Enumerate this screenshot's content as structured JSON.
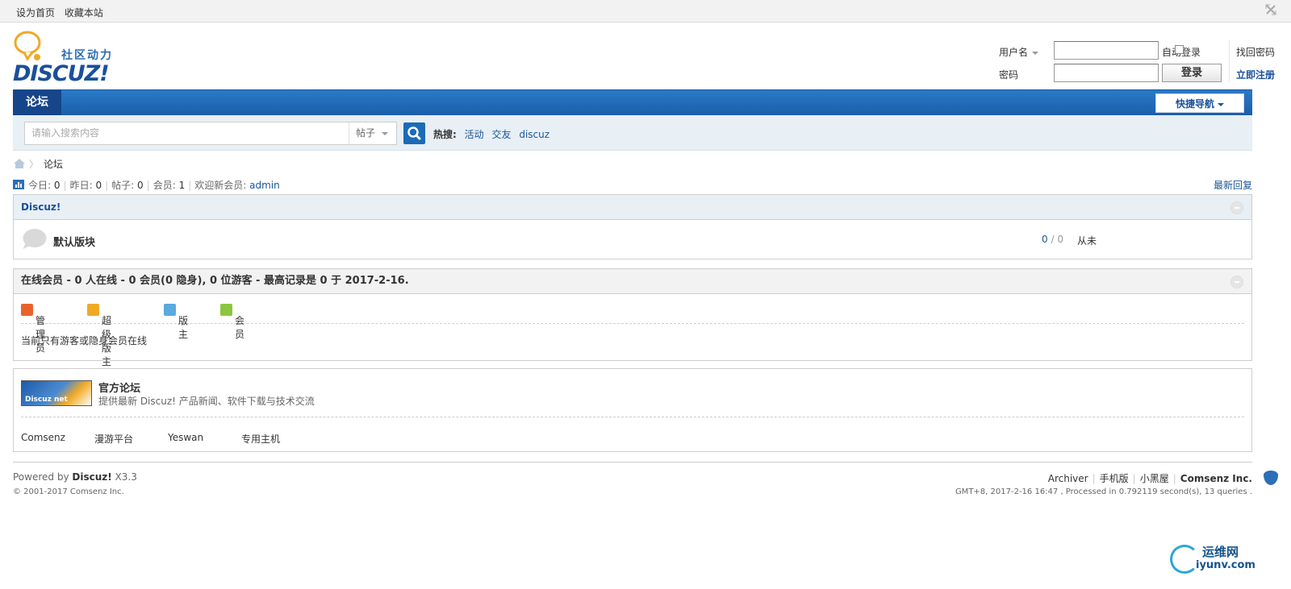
{
  "topbar": {
    "links": [
      "设为首页",
      "收藏本站"
    ]
  },
  "logo": {
    "tagline": "社区动力",
    "wordmark": "DISCUZ!"
  },
  "login": {
    "username_label": "用户名",
    "password_label": "密码",
    "autologin_label": "自动登录",
    "login_button": "登录",
    "find_password": "找回密码",
    "register": "立即注册"
  },
  "nav": {
    "tab": "论坛",
    "quick_nav": "快捷导航"
  },
  "search": {
    "placeholder": "请输入搜索内容",
    "type": "帖子",
    "hot_label": "热搜:",
    "hot_terms": [
      "活动",
      "交友",
      "discuz"
    ]
  },
  "breadcrumb": {
    "current": "论坛"
  },
  "stats": {
    "today_label": "今日:",
    "today": "0",
    "yesterday_label": "昨日:",
    "yesterday": "0",
    "posts_label": "帖子:",
    "posts": "0",
    "members_label": "会员:",
    "members": "1",
    "newest_label": "欢迎新会员:",
    "newest": "admin",
    "latest_reply": "最新回复"
  },
  "category": {
    "title": "Discuz!",
    "forums": [
      {
        "name": "默认版块",
        "topics": "0",
        "sep": "/",
        "posts": "0",
        "last": "从未"
      }
    ]
  },
  "online": {
    "title": "在线会员 - 0 人在线 - 0 会员(0 隐身), 0 位游客 - 最高记录是 0 于 2017-2-16.",
    "legend": [
      "管理员",
      "超级版主",
      "版主",
      "会员"
    ],
    "message": "当前只有游客或隐身会员在线"
  },
  "links": {
    "featured_image_text": "Discuz net",
    "featured_title": "官方论坛",
    "featured_desc": "提供最新 Discuz! 产品新闻、软件下载与技术交流",
    "items": [
      "Comsenz",
      "漫游平台",
      "Yeswan",
      "专用主机"
    ]
  },
  "footer": {
    "powered_prefix": "Powered by ",
    "powered_brand": "Discuz!",
    "powered_version": " X3.3",
    "copyright": "© 2001-2017 Comsenz Inc.",
    "links": [
      "Archiver",
      "手机版",
      "小黑屋"
    ],
    "company": "Comsenz Inc.",
    "processed": "GMT+8, 2017-2-16 16:47 , Processed in 0.792119 second(s), 13 queries ."
  },
  "watermark": {
    "line1": "运维网",
    "line2": "iyunv.com"
  },
  "colors": {
    "brand_blue": "#1b5ea9",
    "link_blue": "#1a5699",
    "search_bg": "#e8eff5",
    "admin_icon": "#e8632c",
    "supermod_icon": "#f0a926",
    "mod_icon": "#5aa9e0",
    "member_icon": "#8cc63f"
  }
}
